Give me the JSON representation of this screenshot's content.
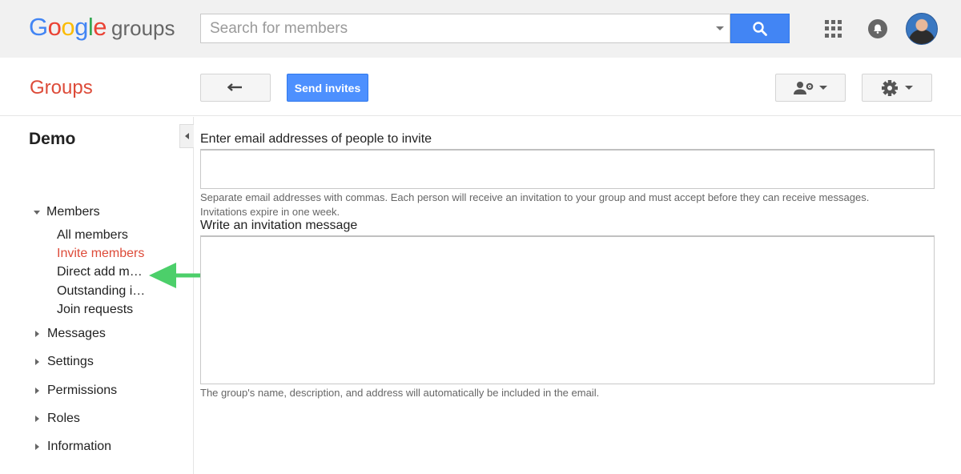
{
  "header": {
    "logo": {
      "letters": [
        "G",
        "o",
        "o",
        "g",
        "l",
        "e"
      ],
      "suffix": "groups"
    },
    "search": {
      "placeholder": "Search for members",
      "value": ""
    },
    "icons": [
      "search-icon",
      "apps-grid-icon",
      "notifications-bell-icon",
      "user-avatar"
    ]
  },
  "toolbar": {
    "section_title": "Groups",
    "send_label": "Send invites",
    "icons": [
      "back-arrow-icon",
      "member-settings-icon",
      "gear-icon"
    ]
  },
  "sidebar": {
    "group_name": "Demo",
    "members_section": "Members",
    "member_items": [
      {
        "label": "All members",
        "active": false
      },
      {
        "label": "Invite members",
        "active": true
      },
      {
        "label": "Direct add m…",
        "active": false
      },
      {
        "label": "Outstanding i…",
        "active": false
      },
      {
        "label": "Join requests",
        "active": false
      }
    ],
    "sections": [
      "Messages",
      "Settings",
      "Permissions",
      "Roles",
      "Information"
    ]
  },
  "form": {
    "emails_label": "Enter email addresses of people to invite",
    "emails_value": "",
    "emails_hint_line1": "Separate email addresses with commas. Each person will receive an invitation to your group and must accept before they can receive messages.",
    "emails_hint_line2": "Invitations expire in one week.",
    "message_label": "Write an invitation message",
    "message_value": "",
    "message_hint": "The group's name, description, and address will automatically be included in the email."
  },
  "colors": {
    "accent_red": "#dd4b39",
    "button_blue": "#4d90fe",
    "annotation_arrow": "#4ccf6a"
  }
}
